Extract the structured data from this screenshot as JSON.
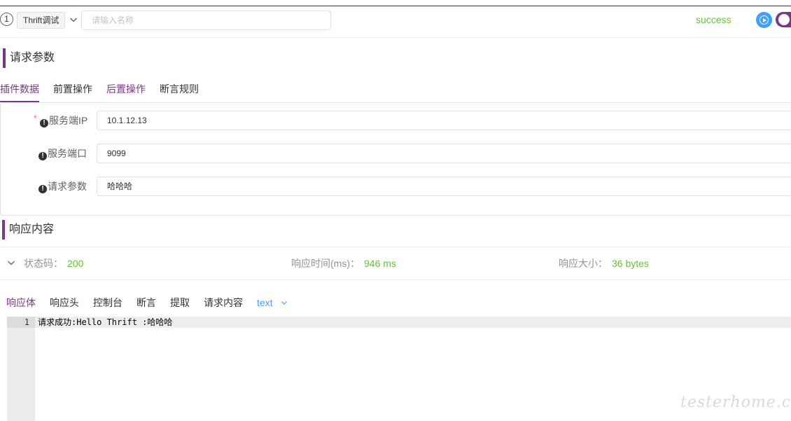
{
  "header": {
    "step_number": "1",
    "type_label": "Thrift调试",
    "name_placeholder": "请输入名称",
    "name_value": "",
    "status": "success"
  },
  "request": {
    "section_title": "请求参数",
    "tabs": [
      {
        "label": "插件数据",
        "active": true
      },
      {
        "label": "前置操作",
        "active": false
      },
      {
        "label": "后置操作",
        "active": false
      },
      {
        "label": "断言规则",
        "active": false
      }
    ],
    "fields": [
      {
        "label": "服务端IP",
        "required": true,
        "value": "10.1.12.13"
      },
      {
        "label": "服务端口",
        "required": false,
        "value": "9099"
      },
      {
        "label": "请求参数",
        "required": false,
        "value": "哈哈哈"
      }
    ]
  },
  "response": {
    "section_title": "响应内容",
    "status_code_label": "状态码：",
    "status_code": "200",
    "time_label": "响应时间(ms)：",
    "time_value": "946 ms",
    "size_label": "响应大小：",
    "size_value": "36 bytes",
    "tabs": [
      {
        "label": "响应体",
        "active": true
      },
      {
        "label": "响应头",
        "active": false
      },
      {
        "label": "控制台",
        "active": false
      },
      {
        "label": "断言",
        "active": false
      },
      {
        "label": "提取",
        "active": false
      },
      {
        "label": "请求内容",
        "active": false
      }
    ],
    "format_select": "text",
    "editor": {
      "line_number": "1",
      "content": "请求成功:Hello Thrift :哈哈哈"
    }
  },
  "watermark": "testerhome.com",
  "colors": {
    "accent": "#783887",
    "success": "#67c23a",
    "primary": "#409eff"
  }
}
